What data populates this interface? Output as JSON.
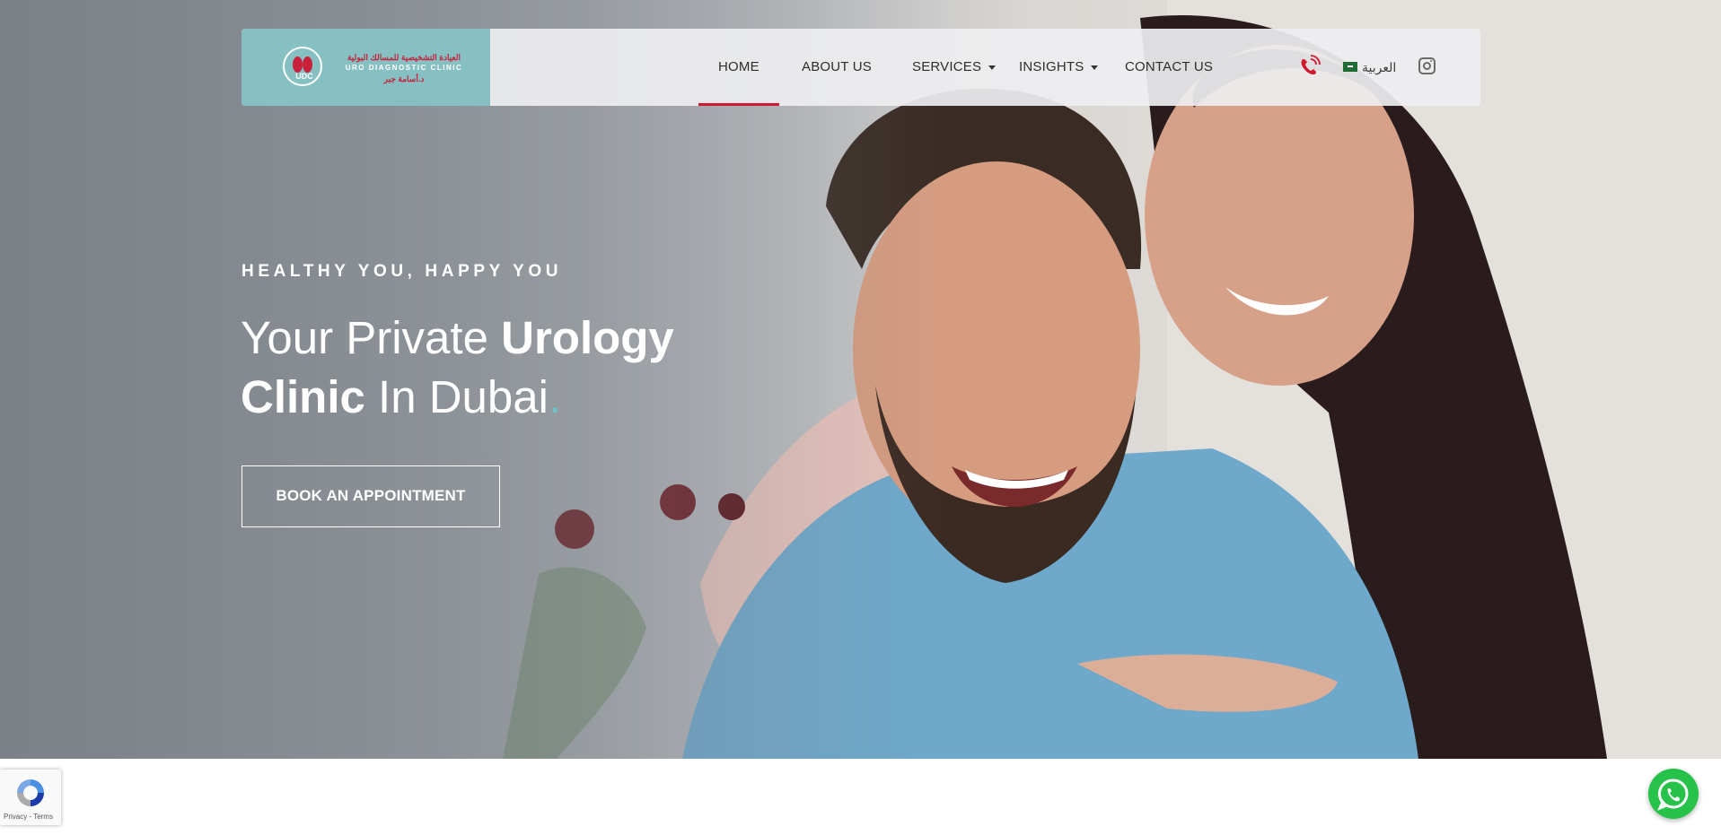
{
  "nav": {
    "logo": {
      "abbr": "UDC",
      "arabic_name": "العيادة التشخيصية للمسالك البولية",
      "english_name": "URO DIAGNOSTIC CLINIC",
      "doctor_name": "د.أسامة جبر"
    },
    "items": [
      {
        "label": "HOME",
        "active": true
      },
      {
        "label": "ABOUT US",
        "active": false
      },
      {
        "label": "SERVICES",
        "dropdown": true
      },
      {
        "label": "INSIGHTS",
        "dropdown": true
      },
      {
        "label": "CONTACT US",
        "active": false
      }
    ],
    "phone_icon": "phone-ringing-icon",
    "language_label": "العربية",
    "flag_icon": "saudi-flag-icon",
    "social_icon": "instagram-icon"
  },
  "hero": {
    "tagline": "HEALTHY YOU, HAPPY YOU",
    "headline": {
      "part1": "Your Private ",
      "part2": "Urology",
      "part3": "Clinic",
      "part4": " In Dubai",
      "part5": "."
    },
    "cta_label": "BOOK AN APPOINTMENT"
  },
  "recaptcha": {
    "text": "Privacy - Terms",
    "icon": "recaptcha-icon"
  },
  "whatsapp": {
    "icon": "whatsapp-icon"
  },
  "colors": {
    "accent_red": "#d0182f",
    "logo_teal": "#86c0c2",
    "headline_dot": "#6fc3c6",
    "whatsapp_green": "#26c249"
  }
}
